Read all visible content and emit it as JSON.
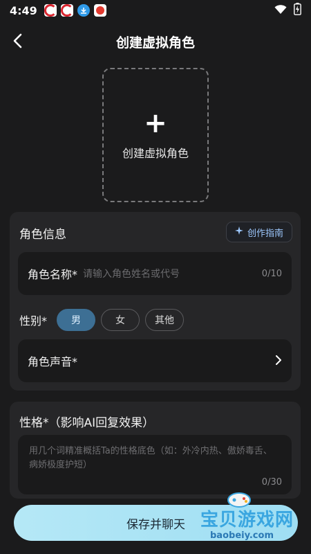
{
  "status_bar": {
    "time": "4:49",
    "notification_icons": [
      "red-circle-app-icon",
      "red-circle-app-icon",
      "download-icon",
      "emblem-app-icon"
    ],
    "system_icons": [
      "wifi-icon",
      "battery-charging-icon"
    ]
  },
  "header": {
    "title": "创建虚拟角色"
  },
  "avatar": {
    "plus": "+",
    "label": "创建虚拟角色"
  },
  "role_info": {
    "title": "角色信息",
    "guide_button": "创作指南",
    "name_field": {
      "label": "角色名称*",
      "placeholder": "请输入角色姓名或代号",
      "counter": "0/10"
    },
    "gender": {
      "label": "性别*",
      "options": [
        "男",
        "女",
        "其他"
      ],
      "selected": "男"
    },
    "voice": {
      "label": "角色声音*"
    }
  },
  "personality": {
    "title": "性格*（影响AI回复效果）",
    "placeholder": "用几个词精准概括Ta的性格底色（如：外冷内热、傲娇毒舌、病娇极度护短）",
    "counter": "0/30"
  },
  "footer": {
    "save_button": "保存并聊天"
  },
  "watermark": {
    "text": "宝贝游戏网",
    "url": "baobeiy.com"
  },
  "colors": {
    "background": "#1b1b1c",
    "card": "#262628",
    "accent": "#3d6f94",
    "button": "#a9e3f5"
  }
}
